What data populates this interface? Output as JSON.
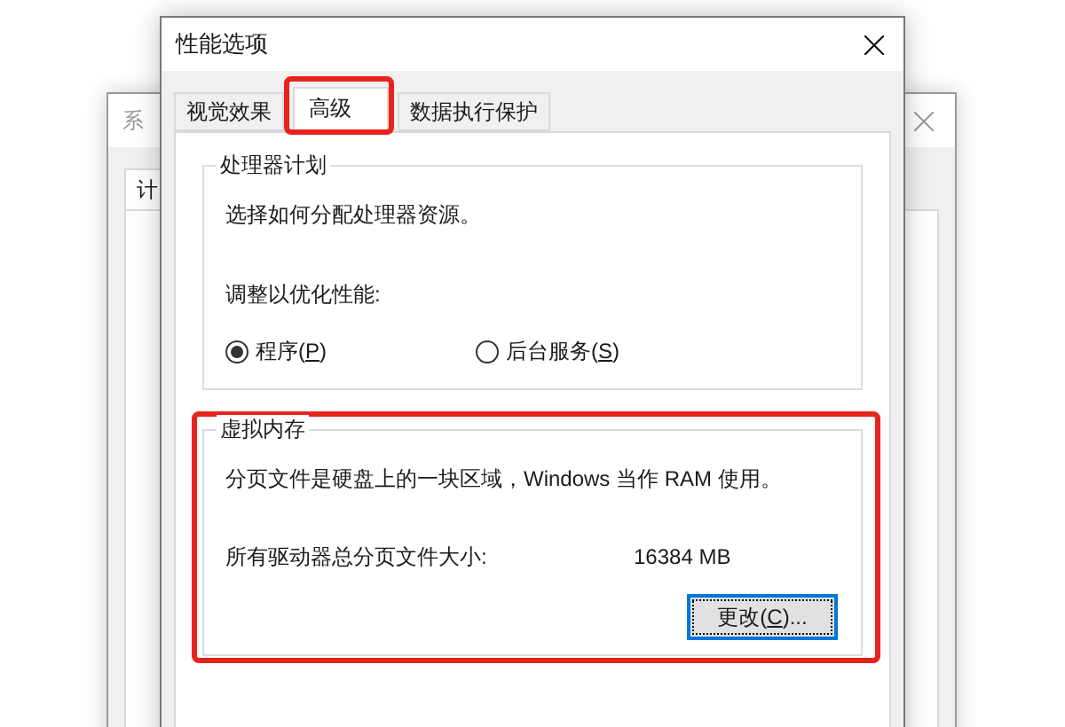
{
  "back_window": {
    "title": "系",
    "tab": "计"
  },
  "window": {
    "title": "性能选项"
  },
  "tabs": [
    {
      "label": "视觉效果",
      "selected": false,
      "highlighted": false
    },
    {
      "label": "高级",
      "selected": true,
      "highlighted": true
    },
    {
      "label": "数据执行保护",
      "selected": false,
      "highlighted": false
    }
  ],
  "processor_group": {
    "title": "处理器计划",
    "highlighted": false,
    "description": "选择如何分配处理器资源。",
    "prompt": "调整以优化性能:",
    "options": [
      {
        "before": "程序(",
        "accel": "P",
        "after": ")",
        "selected": true
      },
      {
        "before": "后台服务(",
        "accel": "S",
        "after": ")",
        "selected": false
      }
    ]
  },
  "memory_group": {
    "title": "虚拟内存",
    "highlighted": true,
    "description": "分页文件是硬盘上的一块区域，Windows 当作 RAM 使用。",
    "size_label": "所有驱动器总分页文件大小:",
    "size_value": "16384 MB",
    "button": {
      "before": "更改(",
      "accel": "C",
      "after": ")..."
    }
  }
}
